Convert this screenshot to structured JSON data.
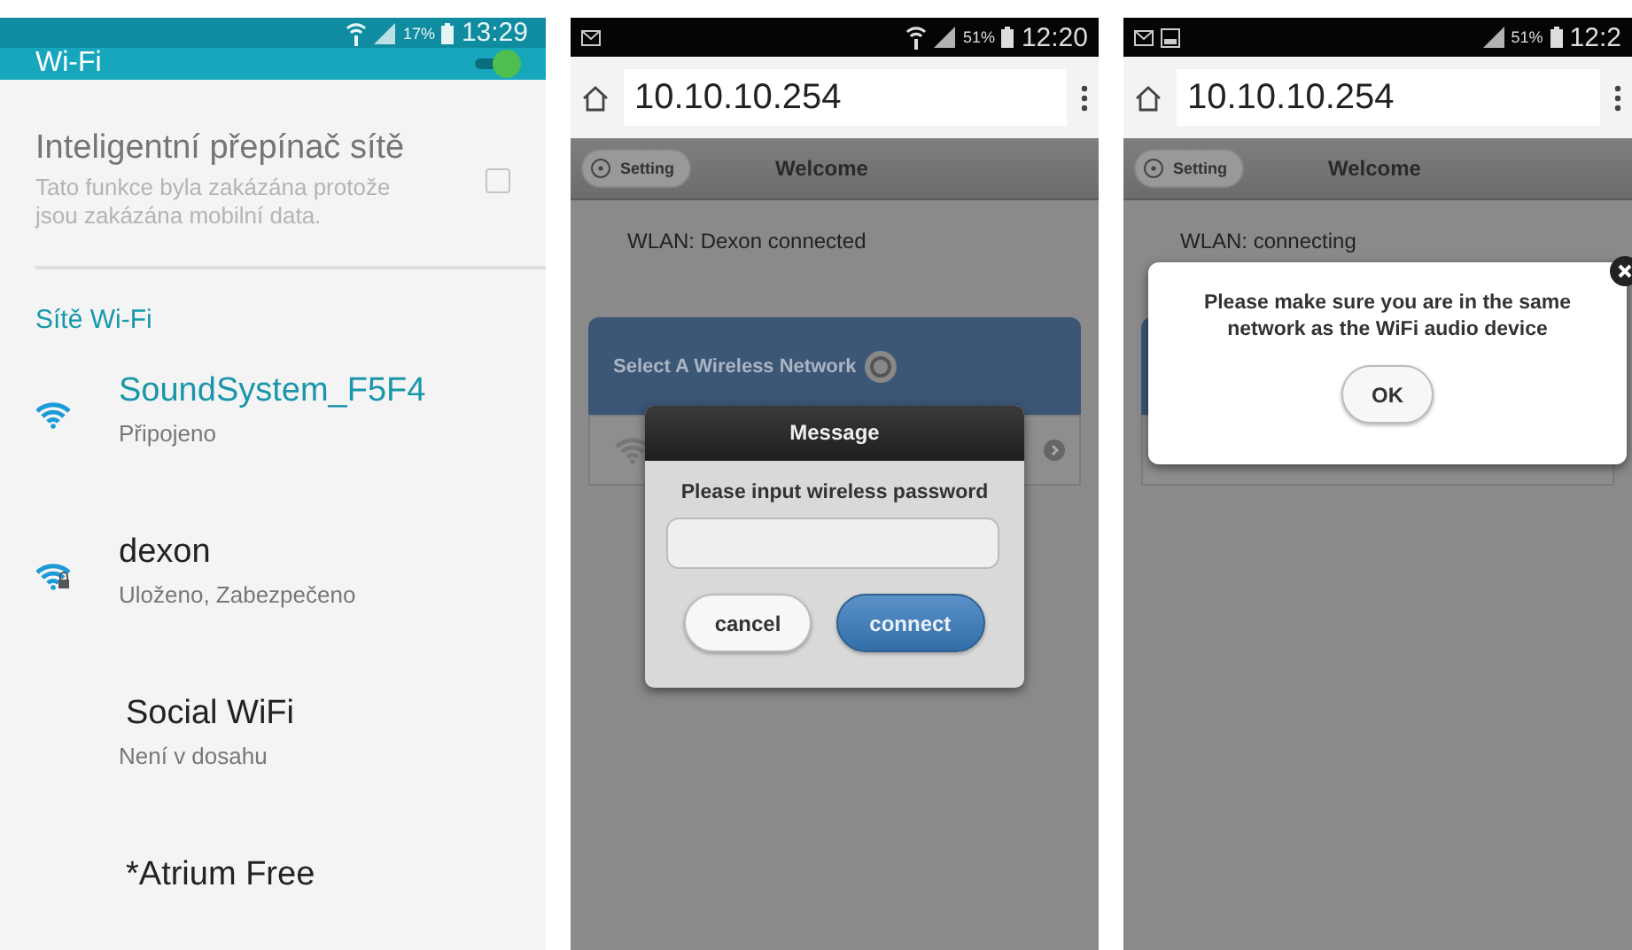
{
  "phones": [
    {
      "kind": "settings",
      "status_bar": {
        "battery": "17%",
        "time": "13:29"
      },
      "title": "Wi-Fi",
      "wifi_on": true,
      "smart_switch": {
        "title": "Inteligentní přepínač sítě",
        "description": "Tato funkce byla zakázána protože jsou zakázána mobilní data.",
        "checked": false
      },
      "section": "Sítě Wi-Fi",
      "networks": [
        {
          "name": "SoundSystem_F5F4",
          "status": "Připojeno",
          "connected": true,
          "secured": false,
          "in_range": true
        },
        {
          "name": "dexon",
          "status": "Uloženo, Zabezpečeno",
          "connected": false,
          "secured": true,
          "in_range": true
        },
        {
          "name": "Social WiFi",
          "status": "Není v dosahu",
          "connected": false,
          "in_range": false
        },
        {
          "name": "*Atrium Free",
          "connected": false,
          "in_range": false
        }
      ]
    },
    {
      "kind": "browser",
      "status_bar": {
        "battery": "51%",
        "time": "12:20",
        "wifi": true
      },
      "url": "10.10.10.254",
      "setting_button": "Setting",
      "page_title": "Welcome",
      "wlan_status": "WLAN: Dexon connected",
      "network_panel_title": "Select A Wireless Network",
      "dialog": {
        "kind": "prompt",
        "title": "Message",
        "prompt": "Please input wireless password",
        "buttons": [
          {
            "label": "cancel",
            "primary": false
          },
          {
            "label": "connect",
            "primary": true
          }
        ]
      }
    },
    {
      "kind": "browser",
      "status_bar": {
        "battery": "51%",
        "time": "12:2",
        "wifi": false
      },
      "url": "10.10.10.254",
      "setting_button": "Setting",
      "page_title": "Welcome",
      "wlan_status": "WLAN: connecting",
      "dialog": {
        "kind": "alert",
        "message": "Please make sure you are in the same network as the WiFi audio device",
        "buttons": [
          {
            "label": "OK",
            "primary": false
          }
        ]
      }
    }
  ]
}
